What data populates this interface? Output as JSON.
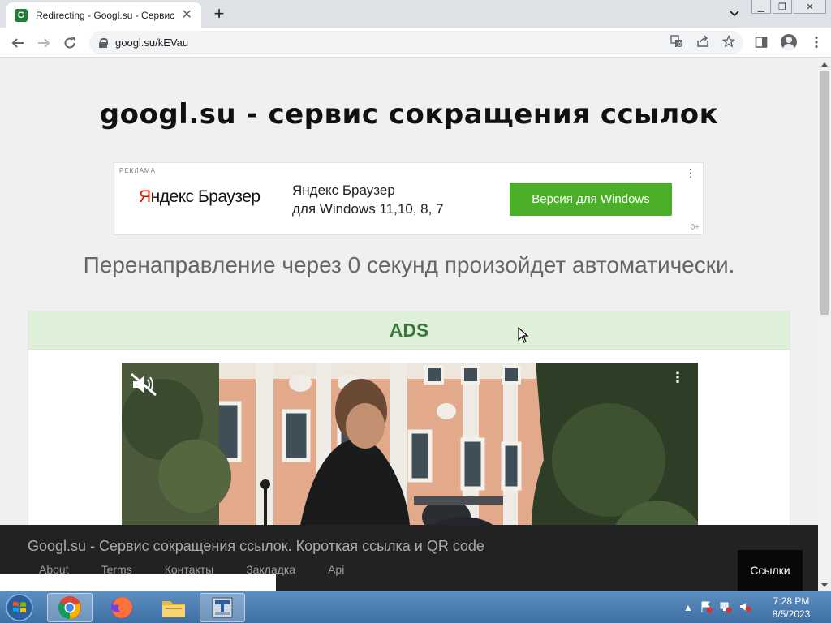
{
  "browser": {
    "tab_title": "Redirecting - Googl.su - Сервис",
    "favicon_letter": "G",
    "url": "googl.su/kEVau"
  },
  "page": {
    "site_title": "googl.su - сервис сокращения ссылок",
    "ad": {
      "label": "РЕКЛАМА",
      "logo_first": "Я",
      "logo_rest": "ндекс Браузер",
      "line1": "Яндекс Браузер",
      "line2": "для Windows 11,10, 8, 7",
      "cta": "Версия для Windows",
      "age": "0+"
    },
    "redirect_text": "Перенаправление через 0 секунд произойдет автоматически.",
    "ads_panel_title": "ADS"
  },
  "footer": {
    "brand": "Googl.su - Сервис сокращения ссылок. Короткая ссылка и QR code",
    "links": [
      "About",
      "Terms",
      "Контакты",
      "Закладка",
      "Api"
    ],
    "button": "Ссылки"
  },
  "taskbar": {
    "time": "7:28 PM",
    "date": "8/5/2023"
  }
}
